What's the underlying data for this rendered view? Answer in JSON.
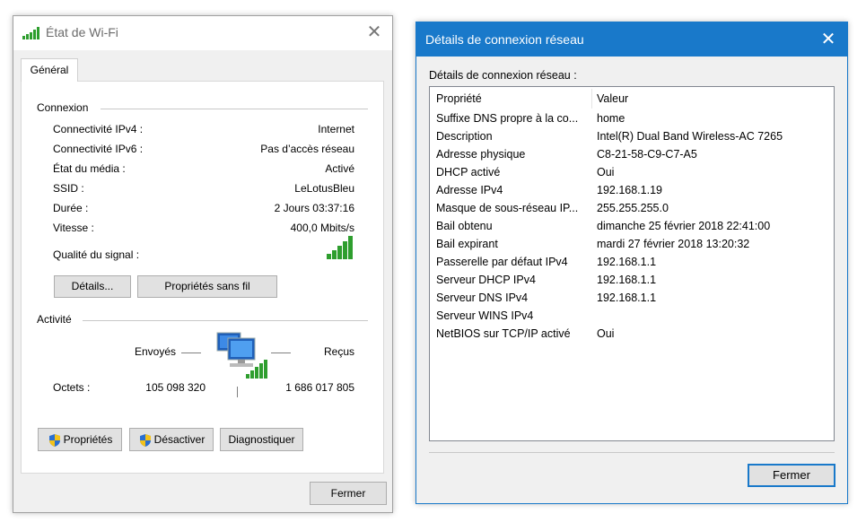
{
  "wifi_status": {
    "title": "État de Wi-Fi",
    "close_glyph": "✕",
    "tab_label": "Général",
    "connection_group": "Connexion",
    "rows": [
      {
        "label": "Connectivité IPv4 :",
        "value": "Internet"
      },
      {
        "label": "Connectivité IPv6 :",
        "value": "Pas d’accès réseau"
      },
      {
        "label": "État du média :",
        "value": "Activé"
      },
      {
        "label": "SSID :",
        "value": "LeLotusBleu"
      },
      {
        "label": "Durée :",
        "value": "2 Jours 03:37:16"
      },
      {
        "label": "Vitesse :",
        "value": "400,0 Mbits/s"
      }
    ],
    "signal_label": "Qualité du signal :",
    "signal_level": "5/5",
    "details_button": "Détails...",
    "wireless_props_button": "Propriétés sans fil",
    "activity_group": "Activité",
    "sent_label": "Envoyés",
    "received_label": "Reçus",
    "bytes_label": "Octets :",
    "bytes_sent": "105 098 320",
    "bytes_received": "1 686 017 805",
    "properties_button": "Propriétés",
    "disable_button": "Désactiver",
    "diagnose_button": "Diagnostiquer",
    "close_button": "Fermer"
  },
  "details_window": {
    "title": "Détails de connexion réseau",
    "close_glyph": "✕",
    "list_label": "Détails de connexion réseau :",
    "columns": [
      "Propriété",
      "Valeur"
    ],
    "rows": [
      {
        "property": "Suffixe DNS propre à la co...",
        "value": "home"
      },
      {
        "property": "Description",
        "value": "Intel(R) Dual Band Wireless-AC 7265"
      },
      {
        "property": "Adresse physique",
        "value": "C8-21-58-C9-C7-A5"
      },
      {
        "property": "DHCP activé",
        "value": "Oui"
      },
      {
        "property": "Adresse IPv4",
        "value": "192.168.1.19"
      },
      {
        "property": "Masque de sous-réseau IP...",
        "value": "255.255.255.0"
      },
      {
        "property": "Bail obtenu",
        "value": "dimanche 25 février 2018 22:41:00"
      },
      {
        "property": "Bail expirant",
        "value": "mardi 27 février 2018 13:20:32"
      },
      {
        "property": "Passerelle par défaut IPv4",
        "value": "192.168.1.1"
      },
      {
        "property": "Serveur DHCP IPv4",
        "value": "192.168.1.1"
      },
      {
        "property": "Serveur DNS IPv4",
        "value": "192.168.1.1"
      },
      {
        "property": "Serveur WINS IPv4",
        "value": ""
      },
      {
        "property": "NetBIOS sur TCP/IP activé",
        "value": "Oui"
      }
    ],
    "close_button": "Fermer"
  },
  "colors": {
    "titlebar_active": "#1979ca",
    "signal_green": "#2e9e2e",
    "button_face": "#e1e1e1"
  }
}
